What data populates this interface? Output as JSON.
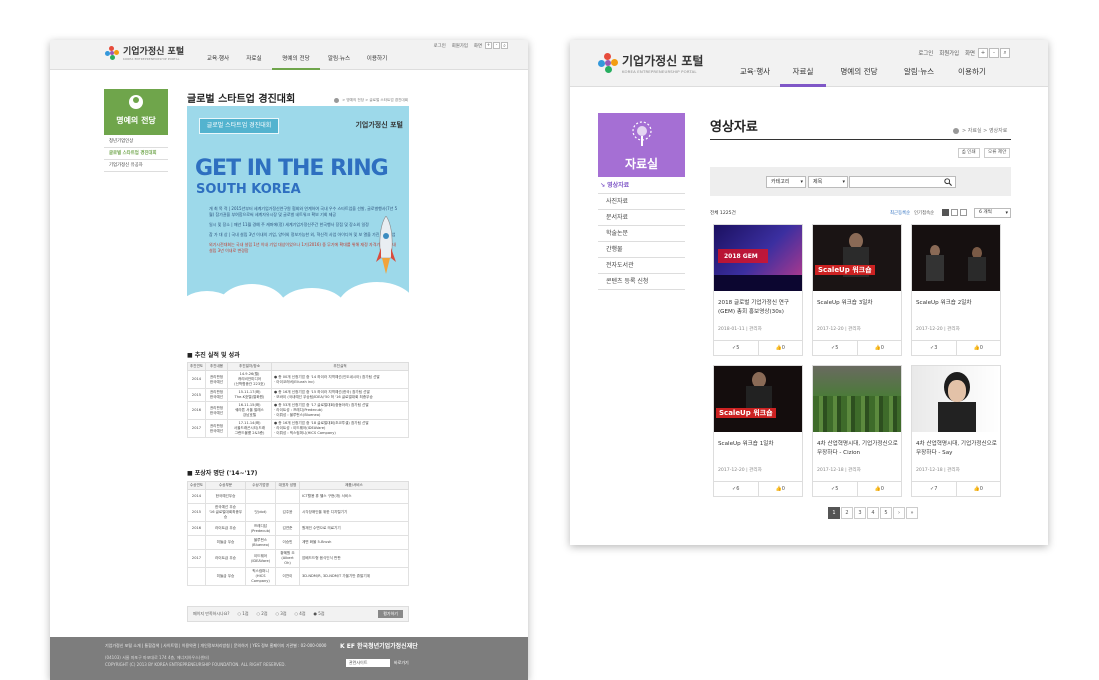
{
  "brand": {
    "logo_text": "기업가정신 포털",
    "logo_sub": "KOREA ENTREPRENEURSHIP PORTAL"
  },
  "colors": {
    "purple": "#7f57c7",
    "green": "#6fa54b",
    "footer": "#7d7d7d"
  },
  "left": {
    "util": {
      "login": "로그인",
      "join": "회원가입",
      "screen": "화면",
      "plus": "+",
      "minus": "-"
    },
    "nav": [
      "교육·행사",
      "자료실",
      "명예의 전당",
      "알림·뉴스",
      "이용하기"
    ],
    "lnb_title": "명예의 전당",
    "lnb": [
      "청년기업인상",
      "글로벌 스타트업 경진대회",
      "기업가정신 유공자"
    ],
    "page_title": "글로벌 스타트업 경진대회",
    "breadcrumb": "> 명예의 전당 > 글로벌 스타트업 경진대회",
    "poster": {
      "tag": "글로벌 스타트업 경진대회",
      "logo": "기업가정신 포털",
      "headline": "GET IN THE RING",
      "sub": "SOUTH KOREA",
      "p1": "개 최 목 적 | 2015년부터 세계기업가정신연구원 협회와 연계하여 국내 우수 스타트업을 선발, 글로벌행사(7년 5월) 참가권을 부여함으로써 세계자유시장 및 글로벌 네트워크 확보 기회 제공",
      "p2": "일시 및 장소 | 매년 11월 경예 주 캐퍼에(정) 세계기업가정신주간 한국행사 장점 및 장소외 일정",
      "p3": "참 가 대 상 | 국내 설립 3년 이내의 기업, 양어외 정보가능한 외, 혁신적 사업 아이디어 및 보\n열을 가진 스타트업",
      "p4": "외기시전대회는 국내 설립 1년 이내 기업 대상이었으나 1기(2016) 중 무기에 확대를 위해 재정 자격기준을 국내 설립 3년 이내로 변경함"
    },
    "sec1": {
      "title": "■ 추진 실적 및 성과",
      "headers": [
        "추진연도",
        "추진내용",
        "추진일자/장소",
        "추진실적"
      ],
      "rows": [
        [
          "2014",
          "권리판정 한국예선",
          "14.9.26(월)\n 캐리비안미디어\n(신학협종관 223호)",
          "● 총 00개 신청기업 중 '14 하이라 지역예선(인도네시아) 참가팀 선발\n· 아이코러버(Ellurah inc)"
        ],
        [
          "2015",
          "권리판정 한국예선",
          "15.11.17(화)\nThe-K호텔(열화원)",
          "● 총 16개 신청기업 중 '15 하이라 지역예선(한국) 참가팀 선발\n· 모바이 (국내예선 우승팀/IDEA/'50 허 '16 글로벌대회 최종우승"
        ],
        [
          "2016",
          "권리판정 한국예선",
          "16.11.15(화)\n쉐라톤 서울 팔레스\n강남호텔",
          "● 총 53개 신청기업 중 '17 글로벌대회(중동아라) 참가팀 선발\n· 라이트성 : 프레디(Predecub)\n· 이뤄성 : 블루펀스(Blueneo)"
        ],
        [
          "2017",
          "권리판정 한국예선",
          "17.11.14(화)\n서울드래곤시티(드래\n그랜드볼룸 2&3층)",
          "● 총 16개 신청기업 중 '18 글로벌대회(초코투셀) 참가팀 선발\n· 라이트성 : 이드웨어(IDEAVare)\n· 이뤄성 : 픽스컴퍼니(HICS Company)"
        ]
      ]
    },
    "sec2": {
      "title": "■ 포상자 명단 ('14~'17)",
      "headers": [
        "수상연도",
        "수상부문",
        "수상기업명",
        "대표자 성명",
        "제품/서비스"
      ],
      "rows": [
        [
          "2014",
          "한국예선우승",
          "",
          "",
          "ICT활용 휴 헬스 구현(개) 서비스"
        ],
        [
          "2015",
          "한국예선 우승\n'16 글로벌대회최종우승",
          "닷(dot)",
          "김주윤",
          "시각장애인을 위한 디지털기기"
        ],
        [
          "2016",
          "라이트급 우승",
          "프레디답\n(Predecub)",
          "김연준",
          "원재인 수면으로 의료기기"
        ],
        [
          "",
          "미들급 우승",
          "블루펀스\n(Blueneo)",
          "이승민",
          "계면 화물 5-Brush"
        ],
        [
          "2017",
          "라이트급 우승",
          "이드웨어\n(IDEAVare)",
          "황혜원 오\n(Albert Oh)",
          "암베드드형 음식인식 판판"
        ],
        [
          "",
          "미들급 우승",
          "픽스컴퍼니\n(HICS\nCompany)",
          "이찬이",
          "3D-NDM/R, 3D-NDM/T 가을기반 휴발기계"
        ]
      ]
    },
    "rating": {
      "q": "페이지 만족하시나요?",
      "o1": "1점",
      "o2": "2점",
      "o3": "3점",
      "o4": "4점",
      "o5": "5점",
      "btn": "평가하기"
    },
    "footer": {
      "links": "기업가정신 포털 소개 | 통합검색 | 사이트맵 | 이용약관 | 개인정보처리방침 | 문의하기 | YES 정보 홈페이지 기관별 : 02-000-0000",
      "addr": "(04103) 서울 마포구 마포대로 174 4층, 에너지하우스(센터)",
      "copy": "COPYRIGHT (C) 2013 BY KOREA ENTREPRENEURSHIP FOUNDATION. ALL RIGHT RESERVED.",
      "kef": "K EF 한국청년기업가정신재단",
      "related": "관련사이트",
      "go": "바로가기"
    }
  },
  "right": {
    "util": {
      "login": "로그인",
      "join": "회원가입",
      "screen": "화면",
      "plus": "+",
      "minus": "-"
    },
    "nav": [
      "교육·행사",
      "자료실",
      "명예의 전당",
      "알림·뉴스",
      "이용하기"
    ],
    "lnb_title": "자료실",
    "lnb": [
      "영상자료",
      "사진자료",
      "문서자료",
      "학술논문",
      "간행물",
      "전자도서관",
      "콘텐츠 등록 신청"
    ],
    "page_title": "영상자료",
    "breadcrumb": "> 자료실 > 영상자료",
    "print": "인쇄",
    "tolist": "오류 제안",
    "search": {
      "cat": "카테고리",
      "field": "제목"
    },
    "total": "전체 1225건",
    "sort": {
      "latest": "최근등록순",
      "popular": "인기접속순",
      "per": "6 개씩"
    },
    "cards": [
      {
        "title": "2018 글로벌 기업가정신 연구(GEM) 총회 홍보영상(30s)",
        "date": "2018-01-11",
        "author": "관리자",
        "views": "5",
        "likes": "0"
      },
      {
        "title": "ScaleUp 워크숍 3일차",
        "date": "2017-12-20",
        "author": "관리자",
        "views": "5",
        "likes": "0"
      },
      {
        "title": "ScaleUp 워크숍 2일차",
        "date": "2017-12-20",
        "author": "관리자",
        "views": "3",
        "likes": "0"
      },
      {
        "title": "ScaleUp 워크숍 1일차",
        "date": "2017-12-20",
        "author": "관리자",
        "views": "6",
        "likes": "0"
      },
      {
        "title": "4차 산업혁명시대, 기업가정신으로 무장하다 - Cizion",
        "date": "2017-12-18",
        "author": "관리자",
        "views": "5",
        "likes": "0"
      },
      {
        "title": "4차 산업혁명시대, 기업가정신으로 무장하다 - Say",
        "date": "2017-12-18",
        "author": "관리자",
        "views": "7",
        "likes": "0"
      }
    ],
    "thumb_labels": {
      "t1a": "2018 GEM",
      "t2": "ScaleUp 워크숍",
      "t4": "ScaleUp 워크숍"
    },
    "pages": [
      "1",
      "2",
      "3",
      "4",
      "5",
      "›",
      "»"
    ]
  }
}
